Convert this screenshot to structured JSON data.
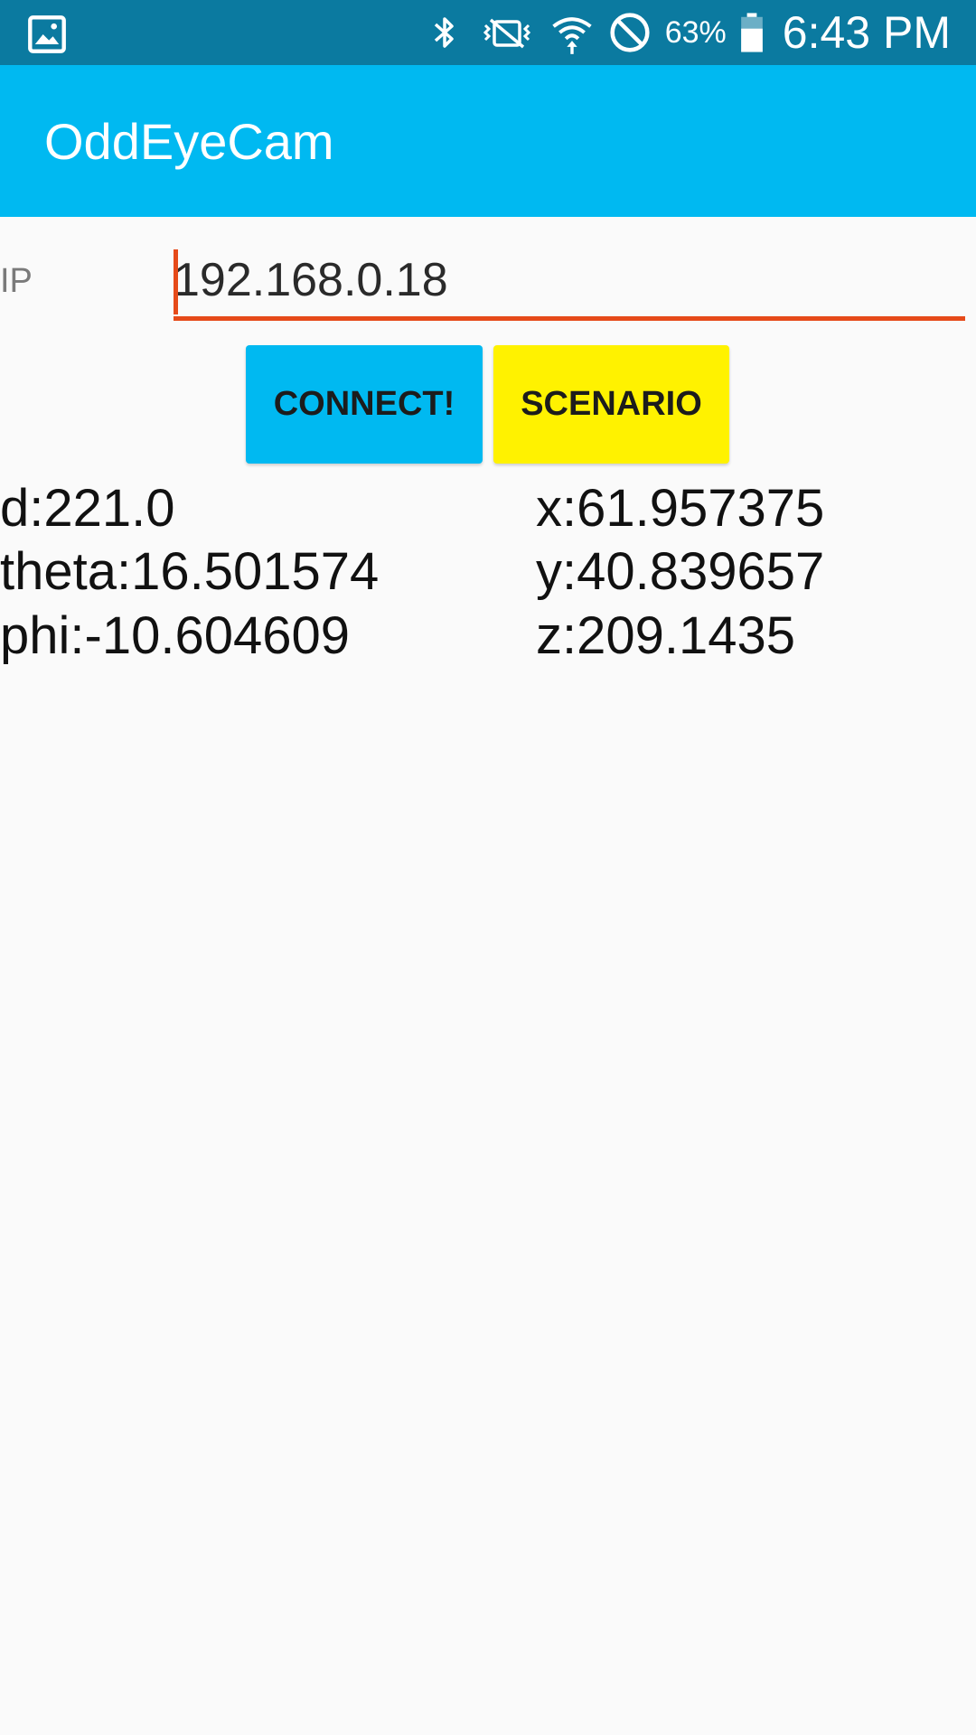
{
  "status_bar": {
    "left_icon": "gallery-icon",
    "icons": [
      "bluetooth-icon",
      "vibrate-icon",
      "wifi-icon",
      "do-not-disturb-icon"
    ],
    "battery_percent": "63%",
    "battery_icon": "battery-icon",
    "time": "6:43 PM",
    "background_color": "#0b7aa0"
  },
  "app_bar": {
    "title": "OddEyeCam",
    "color": "#00b9f1"
  },
  "ip_input": {
    "label": "IP",
    "value": "192.168.0.18",
    "accent_color": "#e64a19"
  },
  "buttons": {
    "connect_label": "CONNECT!",
    "connect_color": "#00b9f1",
    "scenario_label": "SCENARIO",
    "scenario_color": "#fff200"
  },
  "readouts": {
    "d": "d:221.0",
    "theta": "theta:16.501574",
    "phi": "phi:-10.604609",
    "x": "x:61.957375",
    "y": "y:40.839657",
    "z": "z:209.1435"
  }
}
